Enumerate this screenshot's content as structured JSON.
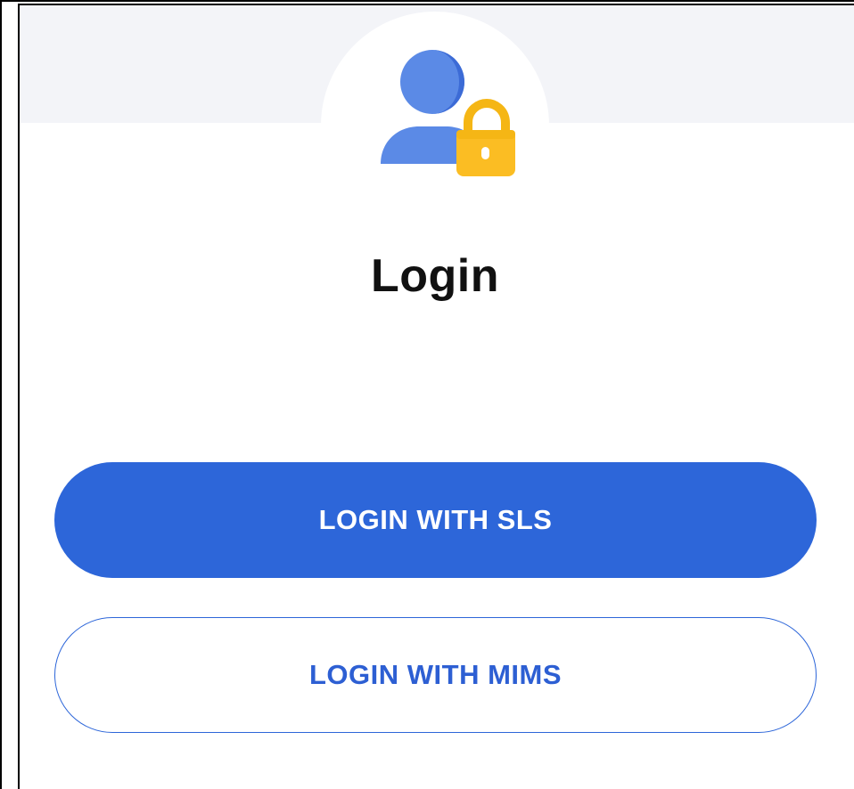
{
  "page": {
    "title": "Login"
  },
  "icon": {
    "name": "user-lock-icon",
    "colors": {
      "person": "#5b8ae6",
      "person_shadow": "#3c6bd6",
      "lock_body": "#fbbd23",
      "lock_shackle": "#f5b615",
      "keyhole": "#ffffff"
    }
  },
  "buttons": {
    "sls_label": "LOGIN WITH SLS",
    "mims_label": "LOGIN WITH MIMS"
  },
  "theme": {
    "primary": "#2d66d9",
    "band": "#f3f4f8",
    "text": "#111111"
  }
}
